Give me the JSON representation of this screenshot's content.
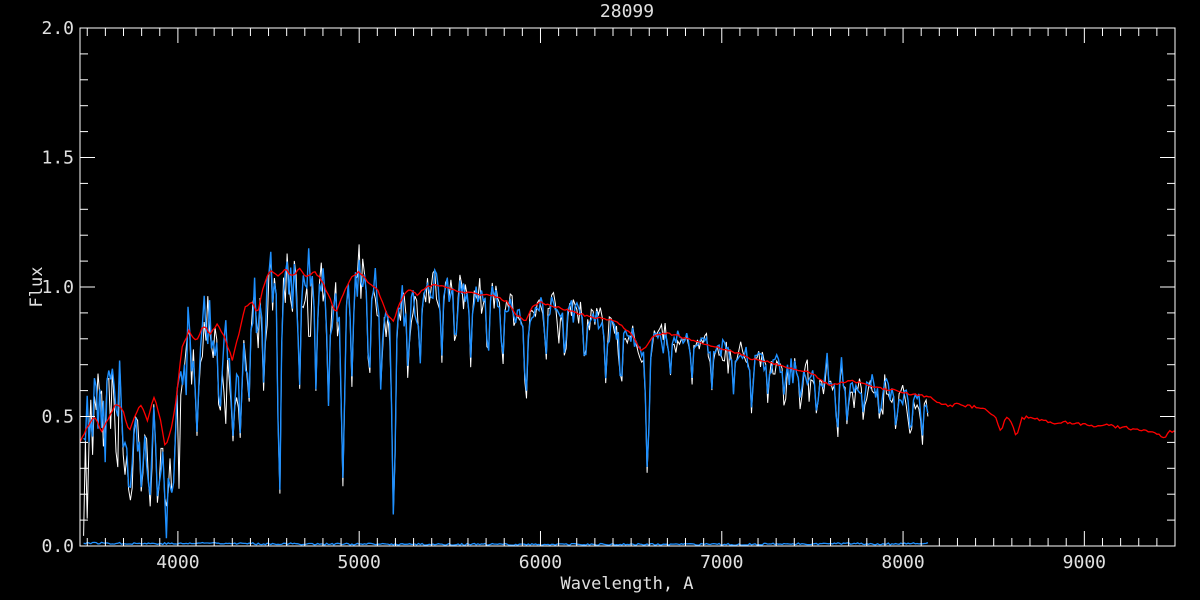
{
  "window": {
    "background": "#000000"
  },
  "chart_data": {
    "type": "line",
    "title": "28099",
    "xlabel": "Wavelength, A",
    "ylabel": "Flux",
    "xlim": [
      3460,
      9500
    ],
    "ylim": [
      0.0,
      2.0
    ],
    "grid": false,
    "legend": "none",
    "background": "#000000",
    "axis_color": "#ffffff",
    "text_color": "#e0e0e0",
    "x_major_ticks": [
      4000,
      5000,
      6000,
      7000,
      8000,
      9000
    ],
    "x_tick_labels": [
      "4000",
      "5000",
      "6000",
      "7000",
      "8000",
      "9000"
    ],
    "x_minor_step": 100,
    "y_major_ticks": [
      0.0,
      0.5,
      1.0,
      1.5,
      2.0
    ],
    "y_tick_labels": [
      "0.0",
      "0.5",
      "1.0",
      "1.5",
      "2.0"
    ],
    "y_minor_step": 0.1,
    "series": [
      {
        "name": "observed-spectrum-white",
        "color": "#ffffff",
        "role": "observed spectrum (underlay)",
        "x_range": [
          3480,
          8147
        ]
      },
      {
        "name": "observed-spectrum-blue",
        "color": "#1e90ff",
        "role": "observed spectrum",
        "x_range": [
          3480,
          8147
        ]
      },
      {
        "name": "error-spectrum-blue",
        "color": "#1e90ff",
        "role": "error spectrum near zero",
        "x_range": [
          3480,
          8147
        ]
      },
      {
        "name": "template-fit-red",
        "color": "#ff0000",
        "role": "smooth template fit",
        "x_range": [
          3460,
          9500
        ]
      }
    ],
    "continuum_points": [
      [
        3460,
        0.4
      ],
      [
        3500,
        0.46
      ],
      [
        3540,
        0.5
      ],
      [
        3580,
        0.44
      ],
      [
        3620,
        0.5
      ],
      [
        3660,
        0.55
      ],
      [
        3700,
        0.52
      ],
      [
        3730,
        0.44
      ],
      [
        3760,
        0.5
      ],
      [
        3800,
        0.55
      ],
      [
        3830,
        0.48
      ],
      [
        3870,
        0.58
      ],
      [
        3900,
        0.5
      ],
      [
        3930,
        0.38
      ],
      [
        3960,
        0.44
      ],
      [
        3990,
        0.56
      ],
      [
        4020,
        0.76
      ],
      [
        4060,
        0.83
      ],
      [
        4100,
        0.79
      ],
      [
        4140,
        0.85
      ],
      [
        4180,
        0.82
      ],
      [
        4220,
        0.86
      ],
      [
        4260,
        0.8
      ],
      [
        4300,
        0.72
      ],
      [
        4330,
        0.8
      ],
      [
        4370,
        0.92
      ],
      [
        4410,
        0.94
      ],
      [
        4440,
        0.9
      ],
      [
        4470,
        1.0
      ],
      [
        4510,
        1.07
      ],
      [
        4550,
        1.04
      ],
      [
        4590,
        1.07
      ],
      [
        4630,
        1.04
      ],
      [
        4670,
        1.07
      ],
      [
        4710,
        1.04
      ],
      [
        4750,
        1.06
      ],
      [
        4790,
        1.03
      ],
      [
        4830,
        0.97
      ],
      [
        4870,
        0.9
      ],
      [
        4910,
        0.97
      ],
      [
        4950,
        1.03
      ],
      [
        5000,
        1.06
      ],
      [
        5050,
        1.02
      ],
      [
        5100,
        0.99
      ],
      [
        5150,
        0.9
      ],
      [
        5190,
        0.87
      ],
      [
        5230,
        0.95
      ],
      [
        5270,
        0.99
      ],
      [
        5320,
        0.97
      ],
      [
        5370,
        1.0
      ],
      [
        5420,
        1.01
      ],
      [
        5470,
        1.0
      ],
      [
        5520,
        0.99
      ],
      [
        5570,
        0.98
      ],
      [
        5620,
        0.98
      ],
      [
        5670,
        0.97
      ],
      [
        5720,
        0.97
      ],
      [
        5770,
        0.96
      ],
      [
        5820,
        0.94
      ],
      [
        5870,
        0.89
      ],
      [
        5920,
        0.87
      ],
      [
        5960,
        0.93
      ],
      [
        6000,
        0.94
      ],
      [
        6050,
        0.93
      ],
      [
        6100,
        0.92
      ],
      [
        6150,
        0.91
      ],
      [
        6200,
        0.9
      ],
      [
        6250,
        0.89
      ],
      [
        6300,
        0.88
      ],
      [
        6350,
        0.88
      ],
      [
        6400,
        0.87
      ],
      [
        6450,
        0.85
      ],
      [
        6500,
        0.82
      ],
      [
        6560,
        0.75
      ],
      [
        6610,
        0.8
      ],
      [
        6660,
        0.82
      ],
      [
        6710,
        0.82
      ],
      [
        6760,
        0.81
      ],
      [
        6810,
        0.8
      ],
      [
        6860,
        0.79
      ],
      [
        6910,
        0.78
      ],
      [
        6960,
        0.77
      ],
      [
        7010,
        0.76
      ],
      [
        7060,
        0.75
      ],
      [
        7110,
        0.74
      ],
      [
        7160,
        0.72
      ],
      [
        7210,
        0.72
      ],
      [
        7260,
        0.71
      ],
      [
        7310,
        0.7
      ],
      [
        7360,
        0.69
      ],
      [
        7410,
        0.68
      ],
      [
        7460,
        0.675
      ],
      [
        7510,
        0.66
      ],
      [
        7560,
        0.635
      ],
      [
        7610,
        0.62
      ],
      [
        7660,
        0.63
      ],
      [
        7710,
        0.64
      ],
      [
        7760,
        0.63
      ],
      [
        7810,
        0.62
      ],
      [
        7860,
        0.61
      ],
      [
        7910,
        0.605
      ],
      [
        7960,
        0.6
      ],
      [
        8010,
        0.59
      ],
      [
        8060,
        0.585
      ],
      [
        8110,
        0.58
      ],
      [
        8160,
        0.57
      ],
      [
        8210,
        0.55
      ],
      [
        8260,
        0.54
      ],
      [
        8310,
        0.55
      ],
      [
        8360,
        0.54
      ],
      [
        8410,
        0.535
      ],
      [
        8460,
        0.53
      ],
      [
        8510,
        0.5
      ],
      [
        8540,
        0.44
      ],
      [
        8570,
        0.5
      ],
      [
        8600,
        0.47
      ],
      [
        8625,
        0.42
      ],
      [
        8655,
        0.49
      ],
      [
        8700,
        0.5
      ],
      [
        8750,
        0.49
      ],
      [
        8800,
        0.48
      ],
      [
        8850,
        0.47
      ],
      [
        8900,
        0.48
      ],
      [
        8950,
        0.47
      ],
      [
        9000,
        0.47
      ],
      [
        9060,
        0.46
      ],
      [
        9120,
        0.47
      ],
      [
        9180,
        0.46
      ],
      [
        9240,
        0.455
      ],
      [
        9300,
        0.45
      ],
      [
        9360,
        0.44
      ],
      [
        9410,
        0.43
      ],
      [
        9440,
        0.41
      ],
      [
        9470,
        0.44
      ],
      [
        9500,
        0.44
      ]
    ],
    "noise_amplitude_points": [
      [
        3460,
        0.13
      ],
      [
        3550,
        0.17
      ],
      [
        3650,
        0.19
      ],
      [
        3750,
        0.21
      ],
      [
        3850,
        0.22
      ],
      [
        3950,
        0.23
      ],
      [
        4000,
        0.2
      ],
      [
        4050,
        0.16
      ],
      [
        4150,
        0.14
      ],
      [
        4250,
        0.13
      ],
      [
        4350,
        0.12
      ],
      [
        4450,
        0.13
      ],
      [
        4550,
        0.12
      ],
      [
        4650,
        0.11
      ],
      [
        4800,
        0.1
      ],
      [
        4950,
        0.09
      ],
      [
        5100,
        0.085
      ],
      [
        5300,
        0.075
      ],
      [
        5500,
        0.06
      ],
      [
        5700,
        0.05
      ],
      [
        5900,
        0.045
      ],
      [
        6100,
        0.045
      ],
      [
        6400,
        0.04
      ],
      [
        6700,
        0.035
      ],
      [
        7000,
        0.037
      ],
      [
        7300,
        0.042
      ],
      [
        7500,
        0.047
      ],
      [
        7700,
        0.05
      ],
      [
        7900,
        0.047
      ],
      [
        8050,
        0.055
      ],
      [
        8147,
        0.065
      ]
    ],
    "absorption_features": [
      [
        3735,
        0.2,
        12
      ],
      [
        3800,
        0.22,
        10
      ],
      [
        3845,
        0.18,
        10
      ],
      [
        3890,
        0.16,
        10
      ],
      [
        3935,
        0.15,
        10
      ],
      [
        3970,
        0.2,
        10
      ],
      [
        4105,
        0.45,
        9
      ],
      [
        4230,
        0.5,
        8
      ],
      [
        4305,
        0.43,
        10
      ],
      [
        4345,
        0.45,
        9
      ],
      [
        4390,
        0.55,
        8
      ],
      [
        4475,
        0.62,
        7
      ],
      [
        4560,
        0.18,
        8
      ],
      [
        4670,
        0.6,
        7
      ],
      [
        4762,
        0.62,
        7
      ],
      [
        4830,
        0.55,
        7
      ],
      [
        4910,
        0.25,
        9
      ],
      [
        4960,
        0.65,
        7
      ],
      [
        5055,
        0.62,
        7
      ],
      [
        5120,
        0.6,
        7
      ],
      [
        5190,
        0.12,
        9
      ],
      [
        5270,
        0.66,
        7
      ],
      [
        5335,
        0.7,
        7
      ],
      [
        5455,
        0.72,
        6
      ],
      [
        5530,
        0.74,
        6
      ],
      [
        5615,
        0.72,
        6
      ],
      [
        5710,
        0.7,
        6
      ],
      [
        5790,
        0.68,
        6
      ],
      [
        5920,
        0.57,
        8
      ],
      [
        6030,
        0.72,
        6
      ],
      [
        6135,
        0.7,
        6
      ],
      [
        6245,
        0.68,
        6
      ],
      [
        6360,
        0.63,
        7
      ],
      [
        6445,
        0.6,
        7
      ],
      [
        6590,
        0.3,
        9
      ],
      [
        6715,
        0.66,
        6
      ],
      [
        6835,
        0.64,
        6
      ],
      [
        6945,
        0.62,
        6
      ],
      [
        7065,
        0.6,
        6
      ],
      [
        7165,
        0.55,
        7
      ],
      [
        7255,
        0.58,
        6
      ],
      [
        7345,
        0.56,
        6
      ],
      [
        7435,
        0.54,
        6
      ],
      [
        7525,
        0.52,
        7
      ],
      [
        7590,
        0.86,
        7
      ],
      [
        7607,
        0.46,
        6
      ],
      [
        7622,
        0.83,
        6
      ],
      [
        7638,
        0.44,
        7
      ],
      [
        7667,
        0.79,
        6
      ],
      [
        7693,
        0.48,
        6
      ],
      [
        7782,
        0.5,
        6
      ],
      [
        7872,
        0.48,
        6
      ],
      [
        7962,
        0.46,
        7
      ],
      [
        8042,
        0.44,
        7
      ],
      [
        8105,
        0.42,
        7
      ]
    ],
    "error_points": [
      [
        3460,
        0.012
      ],
      [
        3700,
        0.01
      ],
      [
        4000,
        0.009
      ],
      [
        4200,
        0.012
      ],
      [
        4400,
        0.009
      ],
      [
        4700,
        0.008
      ],
      [
        5000,
        0.007
      ],
      [
        5500,
        0.0065
      ],
      [
        6000,
        0.006
      ],
      [
        6500,
        0.006
      ],
      [
        7000,
        0.006
      ],
      [
        7600,
        0.009
      ],
      [
        8000,
        0.008
      ],
      [
        8147,
        0.01
      ]
    ]
  }
}
